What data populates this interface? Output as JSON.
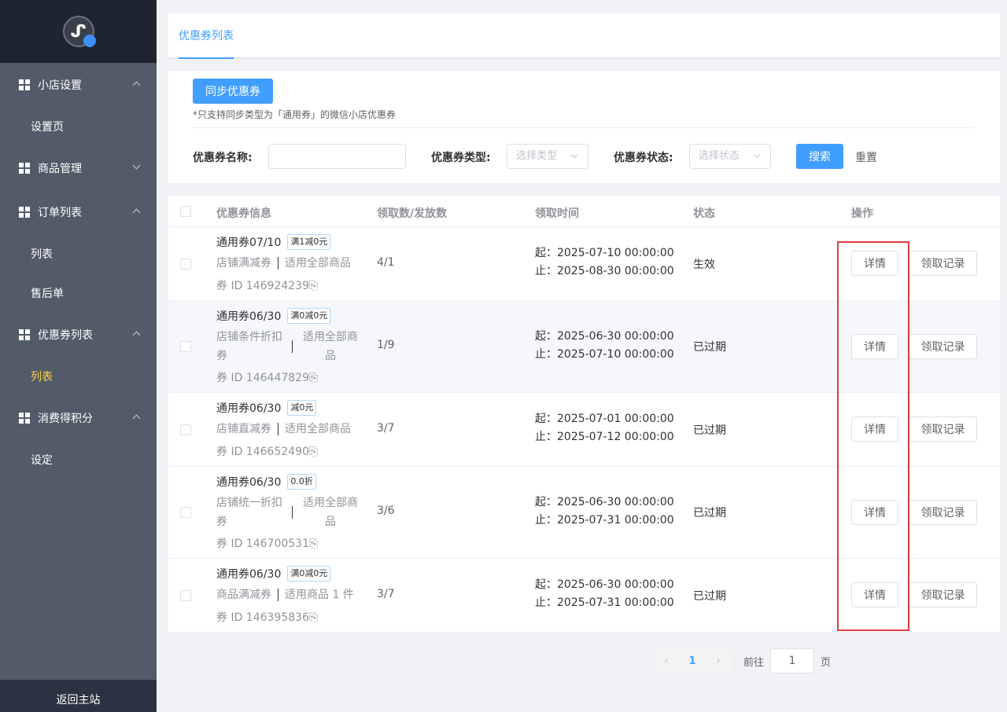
{
  "sidebar": {
    "groups": [
      {
        "label": "小店设置",
        "items": [
          "设置页"
        ]
      },
      {
        "label": "商品管理",
        "items": []
      },
      {
        "label": "订单列表",
        "items": [
          "列表",
          "售后单"
        ]
      },
      {
        "label": "优惠券列表",
        "items": [
          "列表"
        ]
      },
      {
        "label": "消费得积分",
        "items": [
          "设定"
        ]
      }
    ],
    "back_home": "返回主站",
    "active_color": "#ffd04b"
  },
  "tabs": {
    "active": "优惠券列表"
  },
  "filter": {
    "sync_button": "同步优惠券",
    "sync_note": "*只支持同步类型为「通用券」的微信小店优惠券",
    "name_label": "优惠券名称:",
    "name_value": "",
    "type_label": "优惠券类型:",
    "type_placeholder": "选择类型",
    "status_label": "优惠券状态:",
    "status_placeholder": "选择状态",
    "search_button": "搜索",
    "reset_button": "重置"
  },
  "table": {
    "headers": [
      "优惠券信息",
      "领取数/发放数",
      "领取时间",
      "状态",
      "操作"
    ],
    "rows": [
      {
        "title": "通用券07/10",
        "tag": "满1减0元",
        "sub_a": "店铺满减券",
        "sub_b": "适用全部商品",
        "id": "券 ID 146924239",
        "count": "4/1",
        "start": "起：2025-07-10 00:00:00",
        "end": "止：2025-08-30 00:00:00",
        "status": "生效"
      },
      {
        "title": "通用券06/30",
        "tag": "满0减0元",
        "sub_a": "店铺条件折扣券",
        "sub_b": "适用全部商品",
        "id": "券 ID 146447829",
        "count": "1/9",
        "start": "起：2025-06-30 00:00:00",
        "end": "止：2025-07-10 00:00:00",
        "status": "已过期"
      },
      {
        "title": "通用券06/30",
        "tag": "减0元",
        "sub_a": "店铺直减券",
        "sub_b": "适用全部商品",
        "id": "券 ID 146652490",
        "count": "3/7",
        "start": "起：2025-07-01 00:00:00",
        "end": "止：2025-07-12 00:00:00",
        "status": "已过期"
      },
      {
        "title": "通用券06/30",
        "tag": "0.0折",
        "sub_a": "店铺统一折扣券",
        "sub_b": "适用全部商品",
        "id": "券 ID 146700531",
        "count": "3/6",
        "start": "起：2025-06-30 00:00:00",
        "end": "止：2025-07-31 00:00:00",
        "status": "已过期"
      },
      {
        "title": "通用券06/30",
        "tag": "满0减0元",
        "sub_a": "商品满减券",
        "sub_b": "适用商品 1 件",
        "id": "券 ID 146395836",
        "count": "3/7",
        "start": "起：2025-06-30 00:00:00",
        "end": "止：2025-07-31 00:00:00",
        "status": "已过期"
      }
    ],
    "detail_button": "详情",
    "log_button": "领取记录",
    "copy_icon": "copy-icon"
  },
  "pagination": {
    "current": "1",
    "goto_label": "前往",
    "goto_value": "1",
    "page_label": "页"
  },
  "colors": {
    "primary": "#409eff",
    "highlight": "#e03b3b",
    "sidebar": "#525c68",
    "sidebar_top": "#1f2530"
  }
}
